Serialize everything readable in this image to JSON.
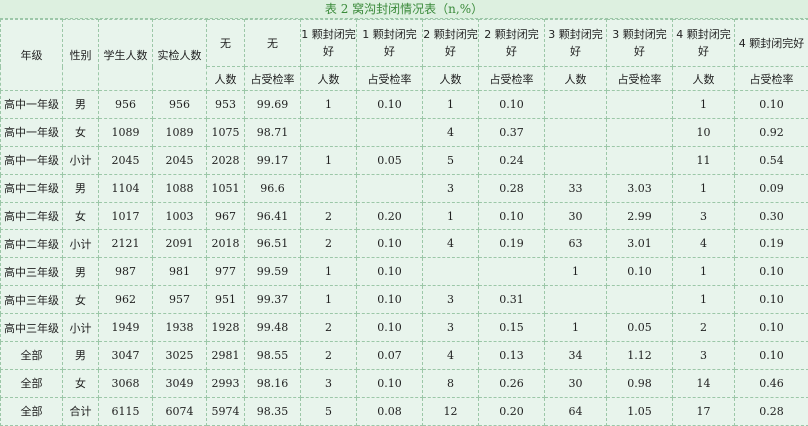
{
  "caption": "表 2 窝沟封闭情况表（n,%）",
  "header": {
    "grade": "年级",
    "gender": "性别",
    "students": "学生人数",
    "examined": "实检人数",
    "groups": [
      {
        "top": "无",
        "sub1": "人数"
      },
      {
        "top": "无",
        "sub1": "占受检率"
      },
      {
        "top": "1 颗封闭完好",
        "sub1": "人数"
      },
      {
        "top": "1 颗封闭完好",
        "sub1": "占受检率"
      },
      {
        "top": "2 颗封闭完好",
        "sub1": "人数"
      },
      {
        "top": "2 颗封闭完好",
        "sub1": "占受检率"
      },
      {
        "top": "3 颗封闭完好",
        "sub1": "人数"
      },
      {
        "top": "3 颗封闭完好",
        "sub1": "占受检率"
      },
      {
        "top": "4 颗封闭完好",
        "sub1": "人数"
      },
      {
        "top": "4 颗封闭完好",
        "sub1": "占受检率"
      }
    ]
  },
  "rows": [
    [
      "高中一年级",
      "男",
      "956",
      "956",
      "953",
      "99.69",
      "1",
      "0.10",
      "1",
      "0.10",
      "",
      "",
      "1",
      "0.10"
    ],
    [
      "高中一年级",
      "女",
      "1089",
      "1089",
      "1075",
      "98.71",
      "",
      "",
      "4",
      "0.37",
      "",
      "",
      "10",
      "0.92"
    ],
    [
      "高中一年级",
      "小计",
      "2045",
      "2045",
      "2028",
      "99.17",
      "1",
      "0.05",
      "5",
      "0.24",
      "",
      "",
      "11",
      "0.54"
    ],
    [
      "高中二年级",
      "男",
      "1104",
      "1088",
      "1051",
      "96.6",
      "",
      "",
      "3",
      "0.28",
      "33",
      "3.03",
      "1",
      "0.09"
    ],
    [
      "高中二年级",
      "女",
      "1017",
      "1003",
      "967",
      "96.41",
      "2",
      "0.20",
      "1",
      "0.10",
      "30",
      "2.99",
      "3",
      "0.30"
    ],
    [
      "高中二年级",
      "小计",
      "2121",
      "2091",
      "2018",
      "96.51",
      "2",
      "0.10",
      "4",
      "0.19",
      "63",
      "3.01",
      "4",
      "0.19"
    ],
    [
      "高中三年级",
      "男",
      "987",
      "981",
      "977",
      "99.59",
      "1",
      "0.10",
      "",
      "",
      "1",
      "0.10",
      "1",
      "0.10"
    ],
    [
      "高中三年级",
      "女",
      "962",
      "957",
      "951",
      "99.37",
      "1",
      "0.10",
      "3",
      "0.31",
      "",
      "",
      "1",
      "0.10"
    ],
    [
      "高中三年级",
      "小计",
      "1949",
      "1938",
      "1928",
      "99.48",
      "2",
      "0.10",
      "3",
      "0.15",
      "1",
      "0.05",
      "2",
      "0.10"
    ],
    [
      "全部",
      "男",
      "3047",
      "3025",
      "2981",
      "98.55",
      "2",
      "0.07",
      "4",
      "0.13",
      "34",
      "1.12",
      "3",
      "0.10"
    ],
    [
      "全部",
      "女",
      "3068",
      "3049",
      "2993",
      "98.16",
      "3",
      "0.10",
      "8",
      "0.26",
      "30",
      "0.98",
      "14",
      "0.46"
    ],
    [
      "全部",
      "合计",
      "6115",
      "6074",
      "5974",
      "98.35",
      "5",
      "0.08",
      "12",
      "0.20",
      "64",
      "1.05",
      "17",
      "0.28"
    ]
  ]
}
